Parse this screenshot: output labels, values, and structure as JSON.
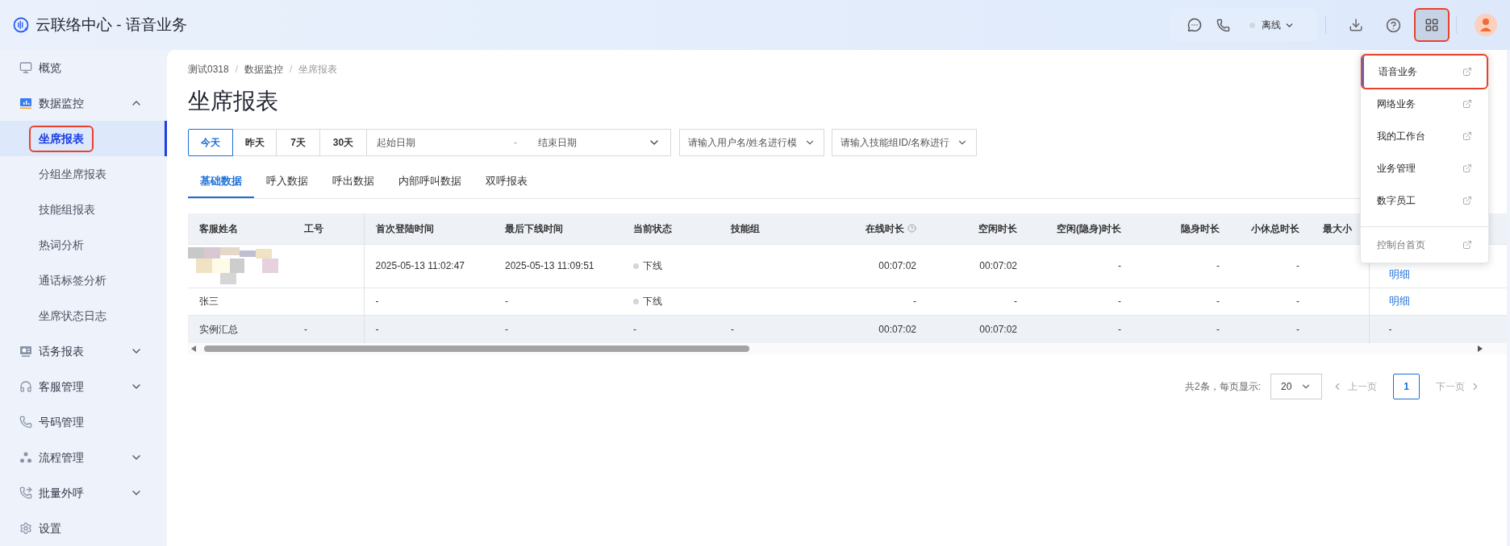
{
  "header": {
    "title": "云联络中心 - 语音业务",
    "status": {
      "label": "离线",
      "color": "#d3d6dc"
    },
    "apps_button": {
      "annotated": true
    }
  },
  "sidebar": {
    "items": [
      {
        "label": "概览"
      },
      {
        "label": "数据监控",
        "expanded": true,
        "children": [
          {
            "label": "坐席报表",
            "selected": true,
            "annotated": true
          },
          {
            "label": "分组坐席报表",
            "selected": false,
            "annotated": false
          },
          {
            "label": "技能组报表",
            "selected": false,
            "annotated": false
          },
          {
            "label": "热词分析",
            "selected": false,
            "annotated": false
          },
          {
            "label": "通话标签分析",
            "selected": false,
            "annotated": false
          },
          {
            "label": "坐席状态日志",
            "selected": false,
            "annotated": false
          }
        ]
      },
      {
        "label": "话务报表",
        "expanded": false
      },
      {
        "label": "客服管理",
        "expanded": false
      },
      {
        "label": "号码管理"
      },
      {
        "label": "流程管理",
        "expanded": false
      },
      {
        "label": "批量外呼",
        "expanded": false
      },
      {
        "label": "设置"
      }
    ]
  },
  "breadcrumb": {
    "separator": "/",
    "items": [
      "测试0318",
      "数据监控",
      "坐席报表"
    ]
  },
  "page_title": "坐席报表",
  "filters": {
    "quick_ranges": [
      {
        "label": "今天",
        "selected": true
      },
      {
        "label": "昨天",
        "selected": false
      },
      {
        "label": "7天",
        "selected": false
      },
      {
        "label": "30天",
        "selected": false
      }
    ],
    "date_range": {
      "start_placeholder": "起始日期",
      "separator": "-",
      "end_placeholder": "结束日期"
    },
    "user_select": {
      "placeholder": "请输入用户名/姓名进行模"
    },
    "group_select": {
      "placeholder": "请输入技能组ID/名称进行"
    }
  },
  "tabs": [
    {
      "label": "基础数据",
      "selected": true
    },
    {
      "label": "呼入数据",
      "selected": false
    },
    {
      "label": "呼出数据",
      "selected": false
    },
    {
      "label": "内部呼叫数据",
      "selected": false
    },
    {
      "label": "双呼报表",
      "selected": false
    }
  ],
  "table": {
    "columns": [
      {
        "label": "客服姓名",
        "help": false
      },
      {
        "label": "工号",
        "help": false
      },
      {
        "label": "首次登陆时间",
        "help": false
      },
      {
        "label": "最后下线时间",
        "help": false
      },
      {
        "label": "当前状态",
        "help": false
      },
      {
        "label": "技能组",
        "help": false
      },
      {
        "label": "在线时长",
        "help": true
      },
      {
        "label": "空闲时长",
        "help": false
      },
      {
        "label": "空闲(隐身)时长",
        "help": false
      },
      {
        "label": "隐身时长",
        "help": false
      },
      {
        "label": "小休总时长",
        "help": false
      },
      {
        "label": "最大小",
        "help": false
      }
    ],
    "rows": [
      {
        "kind": "agent",
        "name_masked": true,
        "first_login": "2025-05-13 11:02:47",
        "last_logout": "2025-05-13 11:09:51",
        "status": {
          "label": "下线",
          "color": "#d3d6dc"
        },
        "online": "00:07:02",
        "idle": "00:07:02",
        "idle_hidden": "-",
        "hidden": "-",
        "break": "-",
        "action": "明细"
      },
      {
        "kind": "agent",
        "name_masked": false,
        "name": "张三",
        "first_login": "-",
        "last_logout": "-",
        "status": {
          "label": "下线",
          "color": "#d3d6dc"
        },
        "online": "-",
        "idle": "-",
        "idle_hidden": "-",
        "hidden": "-",
        "break": "-",
        "action": "明细"
      },
      {
        "kind": "summary",
        "name_masked": false,
        "name": "实例汇总",
        "agent_id": "-",
        "first_login": "-",
        "last_logout": "-",
        "status": {
          "label": "-"
        },
        "skill_group": "-",
        "online": "00:07:02",
        "idle": "00:07:02",
        "idle_hidden": "-",
        "hidden": "-",
        "break": "-",
        "action": "-"
      }
    ]
  },
  "pagination": {
    "summary": "共2条，每页显示:",
    "page_size": "20",
    "prev": {
      "label": "上一页",
      "disabled": true
    },
    "pages": [
      {
        "label": "1",
        "selected": true
      }
    ],
    "next": {
      "label": "下一页",
      "disabled": true
    }
  },
  "apps_menu": {
    "items": [
      {
        "kind": "app",
        "label": "语音业务",
        "selected": true,
        "annotated": true
      },
      {
        "kind": "app",
        "label": "网络业务",
        "selected": false,
        "annotated": false
      },
      {
        "kind": "app",
        "label": "我的工作台",
        "selected": false,
        "annotated": false
      },
      {
        "kind": "app",
        "label": "业务管理",
        "selected": false,
        "annotated": false
      },
      {
        "kind": "app",
        "label": "数字员工",
        "selected": false,
        "annotated": false
      },
      {
        "kind": "home",
        "label": "控制台首页",
        "selected": false,
        "annotated": false
      }
    ]
  }
}
